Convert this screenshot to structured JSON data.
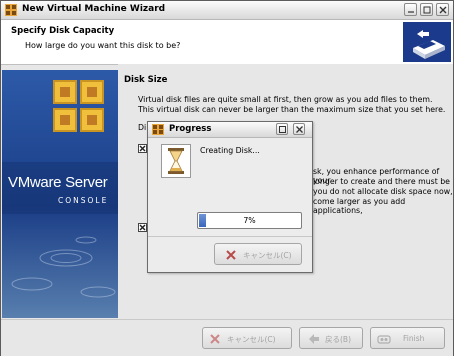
{
  "window": {
    "title": "New Virtual Machine Wizard"
  },
  "header": {
    "title": "Specify Disk Capacity",
    "subtitle": "How large do you want this disk to be?"
  },
  "sidebar": {
    "brand": "VMware Server",
    "console": "CONSOLE"
  },
  "content": {
    "section_title": "Disk Size",
    "paragraph1": "Virtual disk files are quite small at first, then grow as you add files to them. This virtual disk can never be larger than the maximum size that you set here.",
    "frag_di": "Di",
    "frag_line1": "sk, you enhance performance of your",
    "frag_line2": "longer to create and there must be",
    "frag_line3": "you do not allocate disk space now,",
    "frag_line4": "come larger as you add applications,"
  },
  "buttons": {
    "cancel": "キャンセル(C)",
    "back": "戻る(B)",
    "finish": "Finish"
  },
  "dialog": {
    "title": "Progress",
    "message": "Creating Disk...",
    "progress_text": "7%",
    "progress_value": 7,
    "cancel": "キャンセル(C)"
  },
  "colors": {
    "sidebar_bg": "#1a3d86",
    "progress_fill": "#3a66bd",
    "cancel_x": "#b84a4a"
  }
}
